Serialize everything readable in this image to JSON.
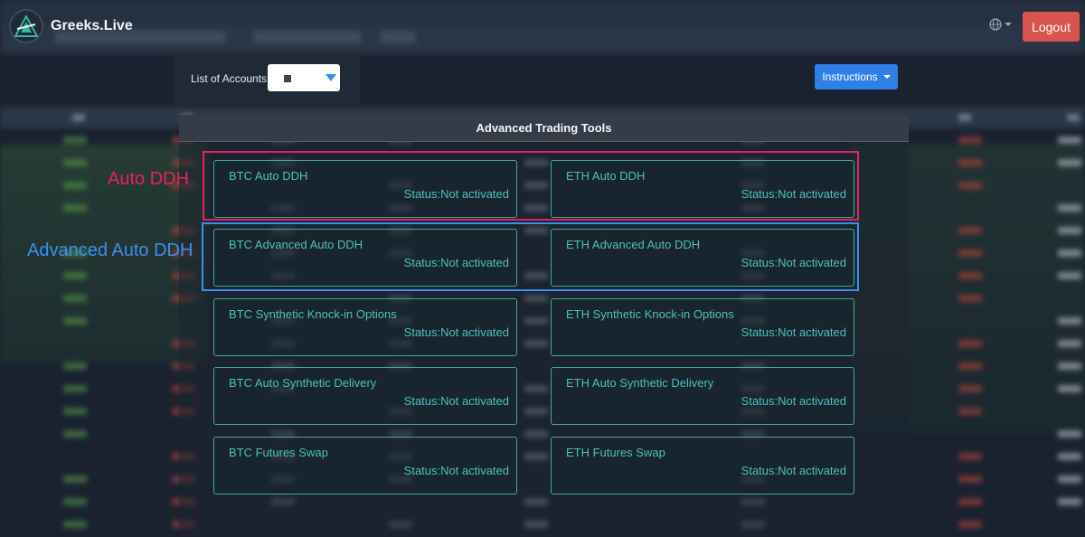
{
  "app": {
    "brand": "Greeks.Live",
    "logout_label": "Logout"
  },
  "accounts": {
    "label": "List of Accounts:"
  },
  "instructions_label": "Instructions",
  "modal": {
    "title": "Advanced Trading Tools",
    "cards": [
      {
        "title": "BTC Auto DDH",
        "status": "Status:Not activated"
      },
      {
        "title": "ETH Auto DDH",
        "status": "Status:Not activated"
      },
      {
        "title": "BTC Advanced Auto DDH",
        "status": "Status:Not activated"
      },
      {
        "title": "ETH Advanced Auto DDH",
        "status": "Status:Not activated"
      },
      {
        "title": "BTC Synthetic Knock-in Options",
        "status": "Status:Not activated"
      },
      {
        "title": "ETH Synthetic Knock-in Options",
        "status": "Status:Not activated"
      },
      {
        "title": "BTC Auto Synthetic Delivery",
        "status": "Status:Not activated"
      },
      {
        "title": "ETH Auto Synthetic Delivery",
        "status": "Status:Not activated"
      },
      {
        "title": "BTC Futures Swap",
        "status": "Status:Not activated"
      },
      {
        "title": "ETH Futures Swap",
        "status": "Status:Not activated"
      }
    ]
  },
  "annotations": {
    "auto_ddh": "Auto DDH",
    "advanced_auto_ddh": "Advanced Auto DDH"
  },
  "icons": {
    "logo": "greeks-live-logo-icon",
    "globe": "globe-icon",
    "caret": "caret-down-icon"
  },
  "colors": {
    "accent_teal": "#4fc0bd",
    "logout_red": "#d9534f",
    "instructions_blue": "#2f7fe8",
    "annotation_red": "#e8245a",
    "annotation_blue": "#3d8ff0"
  }
}
